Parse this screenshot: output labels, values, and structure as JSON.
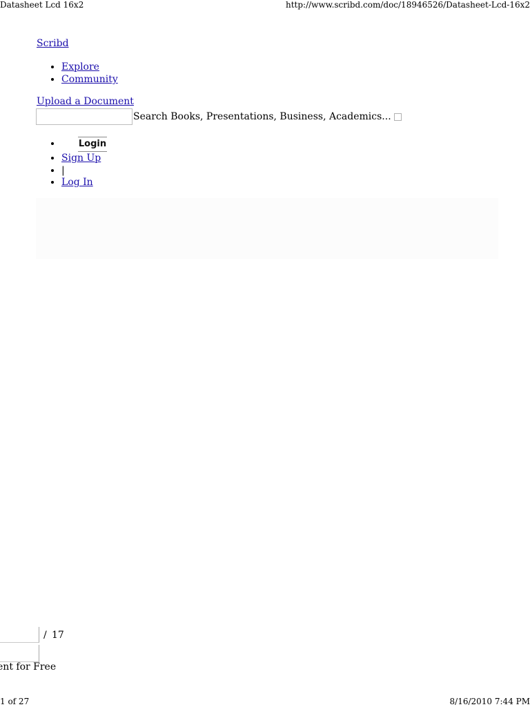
{
  "print_header": {
    "title": "Datasheet Lcd 16x2",
    "url": "http://www.scribd.com/doc/18946526/Datasheet-Lcd-16x2"
  },
  "site": {
    "logo": "Scribd"
  },
  "nav": {
    "items": [
      {
        "label": "Explore"
      },
      {
        "label": "Community"
      }
    ]
  },
  "upload": {
    "label": "Upload a Document"
  },
  "search": {
    "value": "",
    "placeholder_text": "Search Books, Presentations, Business, Academics...",
    "submit_icon": "search-submit-icon"
  },
  "account": {
    "login_button": "Login",
    "signup": "Sign Up",
    "separator": "|",
    "login_link": "Log In"
  },
  "reader": {
    "current_page": "",
    "page_separator": "/",
    "total_pages": "17",
    "download_label": "nent for Free"
  },
  "print_footer": {
    "page_count": "1 of 27",
    "printed_at": "8/16/2010 7:44 PM"
  }
}
